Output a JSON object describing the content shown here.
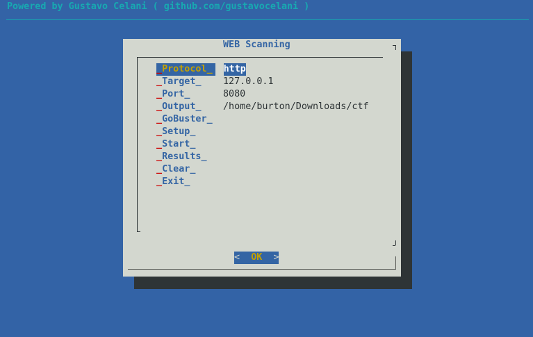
{
  "backtitle": "Powered by Gustavo Celani ( github.com/gustavocelani )",
  "dialog": {
    "title": "WEB Scanning",
    "ok_label": "OK",
    "ok_left": "<",
    "ok_right": ">"
  },
  "menu": {
    "items": [
      {
        "tag": "Protocol",
        "value": "http",
        "selected": true
      },
      {
        "tag": "Target",
        "value": "127.0.0.1"
      },
      {
        "tag": "Port",
        "value": "8080"
      },
      {
        "tag": "Output",
        "value": "/home/burton/Downloads/ctf"
      },
      {
        "tag": "GoBuster",
        "value": ""
      },
      {
        "tag": "Setup",
        "value": ""
      },
      {
        "tag": "Start",
        "value": ""
      },
      {
        "tag": "Results",
        "value": ""
      },
      {
        "tag": "Clear",
        "value": ""
      },
      {
        "tag": "Exit",
        "value": ""
      }
    ]
  },
  "colors": {
    "background": "#3363a6",
    "dialog_bg": "#d3d7cf",
    "accent": "#3465a4",
    "highlight_text": "#c4a000",
    "underscore": "#cc0000",
    "backtitle": "#18a9b1"
  }
}
